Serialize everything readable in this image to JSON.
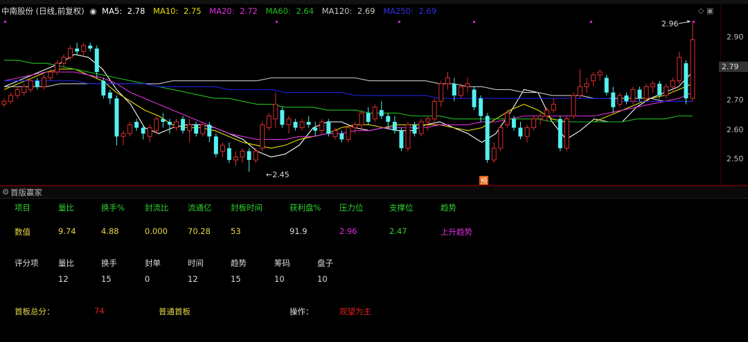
{
  "chart": {
    "stock_title": "中南股份 (日线,前复权)",
    "ma": [
      {
        "label": "MA5:",
        "value": "2.78",
        "color": "#ffffff"
      },
      {
        "label": "MA10:",
        "value": "2.75",
        "color": "#e8e000"
      },
      {
        "label": "MA20:",
        "value": "2.72",
        "color": "#e030e0"
      },
      {
        "label": "MA60:",
        "value": "2.64",
        "color": "#20c020"
      },
      {
        "label": "MA120:",
        "value": "2.69",
        "color": "#c8c8c8"
      },
      {
        "label": "MA250:",
        "value": "2.69",
        "color": "#2020e0"
      }
    ],
    "price_axis": [
      "2.90",
      "2.79",
      "2.70",
      "2.60",
      "2.50"
    ],
    "current_price": "2.79",
    "high_label": "2.96",
    "low_label": "2.45",
    "marker_label": "预",
    "colors": {
      "up": "#e03030",
      "down": "#54f0f0",
      "background": "#000000"
    }
  },
  "chart_data": {
    "type": "candlestick",
    "ylim": [
      2.45,
      2.96
    ],
    "ohlc": [
      [
        2.68,
        2.7,
        2.67,
        2.69
      ],
      [
        2.69,
        2.72,
        2.68,
        2.71
      ],
      [
        2.71,
        2.74,
        2.7,
        2.73
      ],
      [
        2.72,
        2.75,
        2.71,
        2.74
      ],
      [
        2.73,
        2.77,
        2.72,
        2.76
      ],
      [
        2.76,
        2.77,
        2.73,
        2.74
      ],
      [
        2.74,
        2.78,
        2.73,
        2.77
      ],
      [
        2.77,
        2.8,
        2.76,
        2.79
      ],
      [
        2.79,
        2.83,
        2.78,
        2.82
      ],
      [
        2.82,
        2.85,
        2.8,
        2.84
      ],
      [
        2.84,
        2.88,
        2.83,
        2.87
      ],
      [
        2.87,
        2.89,
        2.85,
        2.86
      ],
      [
        2.86,
        2.89,
        2.84,
        2.88
      ],
      [
        2.88,
        2.89,
        2.86,
        2.87
      ],
      [
        2.87,
        2.88,
        2.77,
        2.79
      ],
      [
        2.76,
        2.77,
        2.7,
        2.71
      ],
      [
        2.72,
        2.73,
        2.68,
        2.7
      ],
      [
        2.7,
        2.71,
        2.54,
        2.57
      ],
      [
        2.57,
        2.59,
        2.54,
        2.58
      ],
      [
        2.58,
        2.62,
        2.57,
        2.61
      ],
      [
        2.62,
        2.63,
        2.59,
        2.6
      ],
      [
        2.6,
        2.61,
        2.56,
        2.58
      ],
      [
        2.57,
        2.61,
        2.55,
        2.6
      ],
      [
        2.59,
        2.64,
        2.58,
        2.63
      ],
      [
        2.63,
        2.65,
        2.6,
        2.62
      ],
      [
        2.62,
        2.63,
        2.58,
        2.61
      ],
      [
        2.6,
        2.63,
        2.59,
        2.62
      ],
      [
        2.63,
        2.64,
        2.58,
        2.59
      ],
      [
        2.59,
        2.63,
        2.55,
        2.61
      ],
      [
        2.61,
        2.62,
        2.57,
        2.58
      ],
      [
        2.58,
        2.62,
        2.57,
        2.61
      ],
      [
        2.61,
        2.62,
        2.55,
        2.57
      ],
      [
        2.57,
        2.58,
        2.5,
        2.51
      ],
      [
        2.52,
        2.55,
        2.5,
        2.54
      ],
      [
        2.53,
        2.55,
        2.48,
        2.49
      ],
      [
        2.49,
        2.52,
        2.47,
        2.5
      ],
      [
        2.5,
        2.53,
        2.48,
        2.52
      ],
      [
        2.52,
        2.53,
        2.45,
        2.49
      ],
      [
        2.49,
        2.53,
        2.48,
        2.52
      ],
      [
        2.53,
        2.62,
        2.52,
        2.61
      ],
      [
        2.6,
        2.65,
        2.59,
        2.64
      ],
      [
        2.63,
        2.72,
        2.6,
        2.68
      ],
      [
        2.66,
        2.67,
        2.6,
        2.61
      ],
      [
        2.61,
        2.64,
        2.58,
        2.63
      ],
      [
        2.62,
        2.63,
        2.59,
        2.6
      ],
      [
        2.6,
        2.63,
        2.59,
        2.62
      ],
      [
        2.62,
        2.64,
        2.6,
        2.61
      ],
      [
        2.6,
        2.62,
        2.57,
        2.59
      ],
      [
        2.59,
        2.63,
        2.58,
        2.62
      ],
      [
        2.62,
        2.63,
        2.57,
        2.58
      ],
      [
        2.57,
        2.6,
        2.56,
        2.59
      ],
      [
        2.58,
        2.59,
        2.55,
        2.56
      ],
      [
        2.56,
        2.61,
        2.55,
        2.6
      ],
      [
        2.6,
        2.62,
        2.58,
        2.61
      ],
      [
        2.61,
        2.66,
        2.59,
        2.65
      ],
      [
        2.65,
        2.67,
        2.61,
        2.62
      ],
      [
        2.63,
        2.68,
        2.62,
        2.67
      ],
      [
        2.66,
        2.69,
        2.63,
        2.64
      ],
      [
        2.64,
        2.65,
        2.6,
        2.62
      ],
      [
        2.62,
        2.64,
        2.58,
        2.59
      ],
      [
        2.59,
        2.6,
        2.52,
        2.53
      ],
      [
        2.53,
        2.62,
        2.52,
        2.61
      ],
      [
        2.61,
        2.62,
        2.57,
        2.58
      ],
      [
        2.58,
        2.63,
        2.57,
        2.62
      ],
      [
        2.62,
        2.64,
        2.59,
        2.63
      ],
      [
        2.63,
        2.7,
        2.61,
        2.69
      ],
      [
        2.69,
        2.76,
        2.67,
        2.75
      ],
      [
        2.75,
        2.79,
        2.73,
        2.77
      ],
      [
        2.75,
        2.77,
        2.69,
        2.71
      ],
      [
        2.71,
        2.75,
        2.7,
        2.74
      ],
      [
        2.74,
        2.77,
        2.72,
        2.75
      ],
      [
        2.73,
        2.74,
        2.66,
        2.67
      ],
      [
        2.7,
        2.71,
        2.62,
        2.64
      ],
      [
        2.64,
        2.65,
        2.48,
        2.49
      ],
      [
        2.49,
        2.55,
        2.48,
        2.53
      ],
      [
        2.53,
        2.61,
        2.52,
        2.6
      ],
      [
        2.61,
        2.66,
        2.6,
        2.65
      ],
      [
        2.63,
        2.64,
        2.59,
        2.6
      ],
      [
        2.6,
        2.62,
        2.56,
        2.57
      ],
      [
        2.57,
        2.61,
        2.55,
        2.6
      ],
      [
        2.6,
        2.64,
        2.59,
        2.63
      ],
      [
        2.63,
        2.65,
        2.61,
        2.64
      ],
      [
        2.64,
        2.67,
        2.62,
        2.66
      ],
      [
        2.66,
        2.7,
        2.65,
        2.68
      ],
      [
        2.63,
        2.64,
        2.52,
        2.53
      ],
      [
        2.53,
        2.64,
        2.52,
        2.63
      ],
      [
        2.64,
        2.72,
        2.63,
        2.71
      ],
      [
        2.71,
        2.8,
        2.7,
        2.74
      ],
      [
        2.74,
        2.77,
        2.72,
        2.75
      ],
      [
        2.76,
        2.79,
        2.74,
        2.78
      ],
      [
        2.78,
        2.8,
        2.76,
        2.79
      ],
      [
        2.77,
        2.78,
        2.71,
        2.72
      ],
      [
        2.72,
        2.74,
        2.65,
        2.67
      ],
      [
        2.68,
        2.72,
        2.67,
        2.71
      ],
      [
        2.71,
        2.72,
        2.68,
        2.69
      ],
      [
        2.69,
        2.74,
        2.68,
        2.73
      ],
      [
        2.73,
        2.74,
        2.69,
        2.7
      ],
      [
        2.7,
        2.75,
        2.69,
        2.74
      ],
      [
        2.74,
        2.76,
        2.72,
        2.75
      ],
      [
        2.75,
        2.76,
        2.7,
        2.71
      ],
      [
        2.71,
        2.75,
        2.7,
        2.74
      ],
      [
        2.74,
        2.77,
        2.72,
        2.76
      ],
      [
        2.76,
        2.86,
        2.75,
        2.84
      ],
      [
        2.82,
        2.83,
        2.68,
        2.7
      ],
      [
        2.7,
        2.96,
        2.69,
        2.9
      ]
    ],
    "ma_series": [
      {
        "name": "MA5",
        "color": "#ffffff",
        "values": [
          2.74,
          2.76,
          2.78,
          2.8,
          2.82,
          2.85,
          2.84,
          2.8,
          2.73,
          2.68,
          2.6,
          2.58,
          2.6,
          2.61,
          2.61,
          2.6,
          2.58,
          2.56,
          2.52,
          2.5,
          2.51,
          2.54,
          2.6,
          2.62,
          2.62,
          2.6,
          2.59,
          2.6,
          2.59,
          2.59,
          2.61,
          2.62,
          2.6,
          2.58,
          2.55,
          2.58,
          2.65,
          2.73,
          2.72,
          2.62,
          2.56,
          2.59,
          2.63,
          2.62,
          2.62,
          2.67,
          2.7,
          2.72,
          2.74,
          2.79
        ]
      },
      {
        "name": "MA10",
        "color": "#e8e000",
        "values": [
          2.73,
          2.75,
          2.77,
          2.79,
          2.8,
          2.8,
          2.78,
          2.76,
          2.72,
          2.69,
          2.66,
          2.64,
          2.61,
          2.6,
          2.6,
          2.59,
          2.57,
          2.55,
          2.54,
          2.53,
          2.54,
          2.56,
          2.57,
          2.58,
          2.6,
          2.61,
          2.61,
          2.6,
          2.61,
          2.61,
          2.61,
          2.61,
          2.6,
          2.59,
          2.6,
          2.63,
          2.66,
          2.68,
          2.66,
          2.63,
          2.62,
          2.62,
          2.62,
          2.64,
          2.66,
          2.68,
          2.7,
          2.71,
          2.73,
          2.75
        ]
      },
      {
        "name": "MA20",
        "color": "#e030e0",
        "values": [
          2.76,
          2.77,
          2.78,
          2.79,
          2.79,
          2.79,
          2.78,
          2.77,
          2.75,
          2.72,
          2.7,
          2.68,
          2.66,
          2.64,
          2.62,
          2.6,
          2.58,
          2.57,
          2.56,
          2.56,
          2.56,
          2.57,
          2.57,
          2.58,
          2.58,
          2.59,
          2.59,
          2.6,
          2.6,
          2.6,
          2.6,
          2.61,
          2.61,
          2.61,
          2.62,
          2.62,
          2.63,
          2.64,
          2.64,
          2.64,
          2.64,
          2.64,
          2.64,
          2.65,
          2.66,
          2.67,
          2.68,
          2.69,
          2.7,
          2.72
        ]
      },
      {
        "name": "MA60",
        "color": "#20c020",
        "values": [
          2.83,
          2.83,
          2.82,
          2.82,
          2.81,
          2.8,
          2.79,
          2.78,
          2.77,
          2.76,
          2.75,
          2.74,
          2.73,
          2.72,
          2.71,
          2.7,
          2.7,
          2.69,
          2.68,
          2.68,
          2.67,
          2.67,
          2.67,
          2.66,
          2.66,
          2.66,
          2.65,
          2.65,
          2.65,
          2.64,
          2.64,
          2.64,
          2.63,
          2.63,
          2.63,
          2.63,
          2.63,
          2.63,
          2.63,
          2.62,
          2.62,
          2.62,
          2.62,
          2.62,
          2.62,
          2.63,
          2.63,
          2.63,
          2.64,
          2.64
        ]
      },
      {
        "name": "MA120",
        "color": "#c8c8c8",
        "values": [
          2.74,
          2.74,
          2.74,
          2.74,
          2.75,
          2.75,
          2.75,
          2.75,
          2.75,
          2.75,
          2.75,
          2.75,
          2.76,
          2.76,
          2.76,
          2.76,
          2.76,
          2.76,
          2.76,
          2.77,
          2.77,
          2.77,
          2.77,
          2.77,
          2.77,
          2.77,
          2.76,
          2.76,
          2.76,
          2.76,
          2.76,
          2.75,
          2.75,
          2.74,
          2.74,
          2.73,
          2.73,
          2.72,
          2.72,
          2.71,
          2.71,
          2.71,
          2.7,
          2.7,
          2.7,
          2.7,
          2.7,
          2.69,
          2.69,
          2.69
        ]
      },
      {
        "name": "MA250",
        "color": "#2020e0",
        "values": [
          2.76,
          2.76,
          2.76,
          2.76,
          2.76,
          2.76,
          2.75,
          2.75,
          2.75,
          2.75,
          2.75,
          2.74,
          2.74,
          2.74,
          2.74,
          2.74,
          2.73,
          2.73,
          2.73,
          2.73,
          2.72,
          2.72,
          2.72,
          2.72,
          2.72,
          2.71,
          2.71,
          2.71,
          2.71,
          2.71,
          2.71,
          2.7,
          2.7,
          2.7,
          2.7,
          2.7,
          2.7,
          2.7,
          2.7,
          2.7,
          2.7,
          2.7,
          2.7,
          2.7,
          2.69,
          2.69,
          2.69,
          2.69,
          2.69,
          2.69
        ]
      }
    ]
  },
  "panel": {
    "title": "首版赢家",
    "row1": {
      "headers": [
        "项目",
        "量比",
        "换手%",
        "封流比",
        "流通亿",
        "封板时间",
        "获利盘%",
        "压力位",
        "支撑位",
        "趋势"
      ],
      "label": "数值",
      "values": [
        "9.74",
        "4.88",
        "0.000",
        "70.28",
        "53",
        "91.9",
        "2.96",
        "2.47",
        "上升趋势"
      ]
    },
    "row2": {
      "label": "评分项",
      "headers": [
        "量比",
        "换手",
        "封单",
        "时间",
        "趋势",
        "筹码",
        "盘子"
      ],
      "values": [
        "12",
        "15",
        "0",
        "12",
        "15",
        "10",
        "10"
      ]
    },
    "summary": {
      "total_label": "首板总分：",
      "total_value": "74",
      "type": "普通首板",
      "op_label": "操作：",
      "op_value": "观望为主"
    }
  }
}
